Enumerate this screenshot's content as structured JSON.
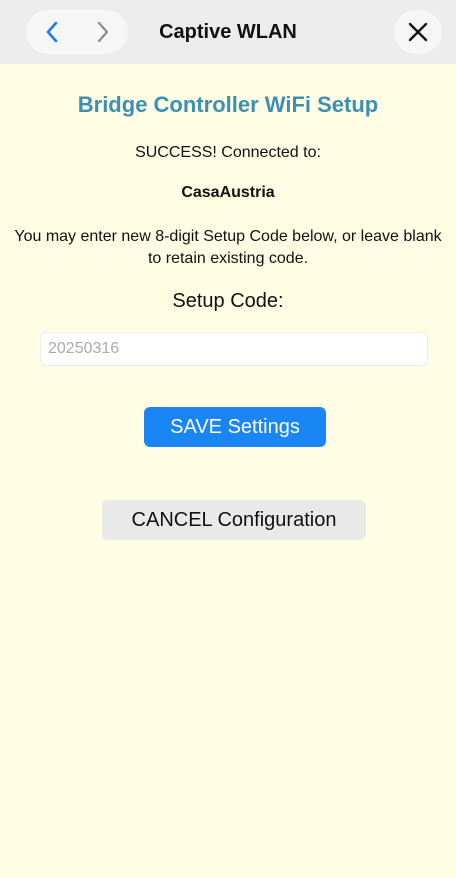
{
  "navbar": {
    "title": "Captive WLAN",
    "back_icon": "chevron-left-icon",
    "forward_icon": "chevron-right-icon",
    "close_icon": "close-icon",
    "colors": {
      "bar": "#ececec",
      "active_icon": "#1a7cf0",
      "disabled_icon": "#8a8a8a"
    }
  },
  "main": {
    "heading": "Bridge Controller WiFi Setup",
    "success_text": "SUCCESS! Connected to:",
    "network_name": "CasaAustria",
    "instructions": "You may enter new 8-digit Setup Code below, or leave blank to retain existing code.",
    "setup_code_label": "Setup Code:",
    "setup_code_input": {
      "value": "",
      "placeholder": "20250316"
    },
    "save_button_label": "SAVE Settings",
    "cancel_button_label": "CANCEL Configuration",
    "colors": {
      "background": "#fffde3",
      "heading": "#3d8fb4",
      "save_button": "#1a85f5",
      "cancel_button": "#e9e9e9"
    }
  }
}
